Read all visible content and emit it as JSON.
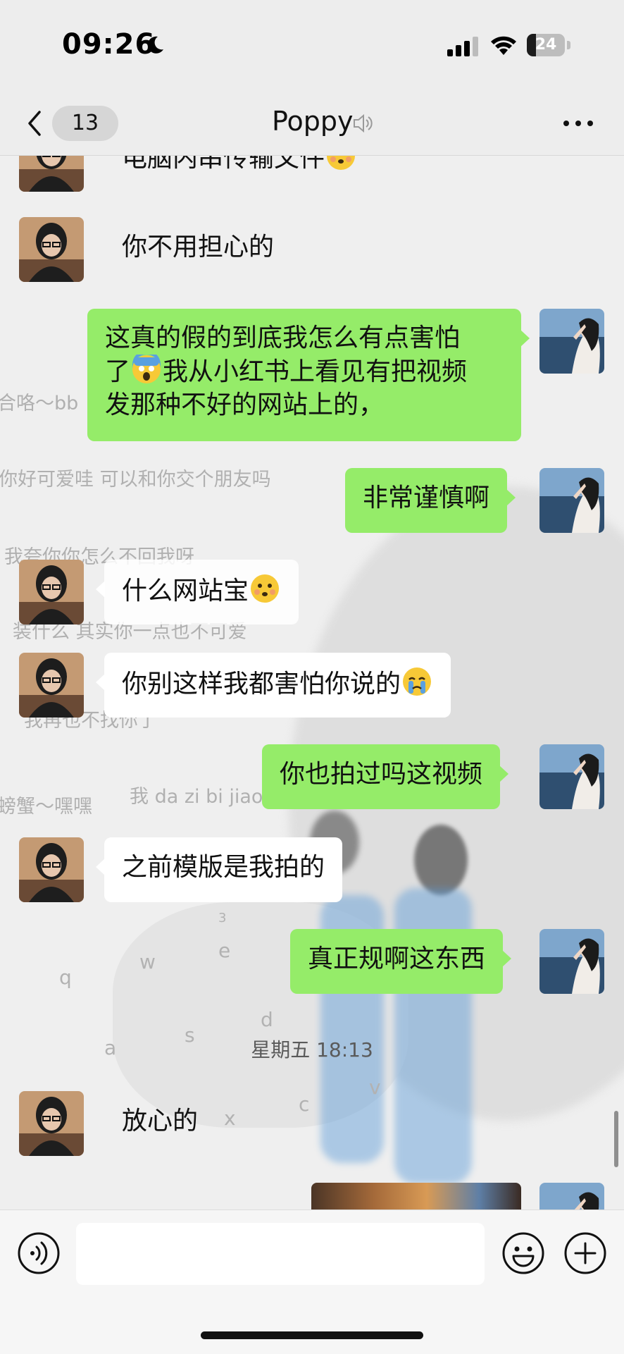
{
  "status_bar": {
    "time": "09:26",
    "battery": "24",
    "battery_level": 0.24
  },
  "nav": {
    "unread_count": "13",
    "title": "Poppy"
  },
  "background_text": [
    "合咯～bb",
    "你好可爱哇   可以和你交个朋友吗",
    "我夸你你怎么不回我呀",
    "装什么   其实你一点也不可爱",
    "我再也不找你了",
    "螃蟹～嘿嘿",
    "我 da zi bi jiao"
  ],
  "background_keys": [
    "q",
    "w",
    "e",
    "a",
    "s",
    "d",
    "x",
    "c",
    "v",
    "3"
  ],
  "messages": {
    "m0": "电脑内串传输文件",
    "m1": "你不用担心的",
    "m2_line1": "这真的假的到底我怎么有点害怕",
    "m2_line2_a": "了",
    "m2_line2_b": "我从小红书上看见有把视频",
    "m2_line3": "发那种不好的网站上的，",
    "m3": "非常谨慎啊",
    "m4": "什么网站宝",
    "m5": "你别这样我都害怕你说的",
    "m6": "你也拍过吗这视频",
    "m7": "之前模版是我拍的",
    "m8": "真正规啊这东西",
    "timestamp": "星期五 18:13",
    "m9": "放心的"
  },
  "input": {
    "placeholder": ""
  },
  "colors": {
    "outgoing_bubble": "#95ec69",
    "incoming_bubble": "#ffffff",
    "background": "#ededed"
  },
  "icons": [
    "moon-icon",
    "signal-icon",
    "wifi-icon",
    "battery-icon",
    "chevron-left-icon",
    "mute-icon",
    "more-icon",
    "voice-icon",
    "emoji-icon",
    "plus-icon"
  ]
}
